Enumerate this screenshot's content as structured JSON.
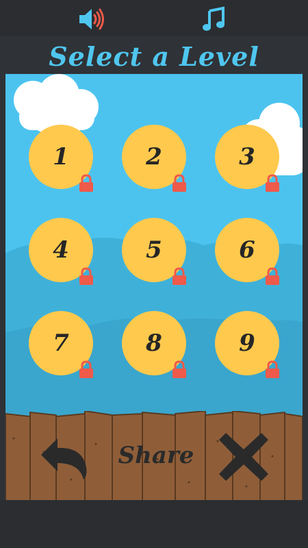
{
  "title": "Select a Level",
  "top_icons": {
    "sound": "speaker-icon",
    "music": "music-note-icon"
  },
  "levels": [
    {
      "number": "1",
      "locked": true
    },
    {
      "number": "2",
      "locked": true
    },
    {
      "number": "3",
      "locked": true
    },
    {
      "number": "4",
      "locked": true
    },
    {
      "number": "5",
      "locked": true
    },
    {
      "number": "6",
      "locked": true
    },
    {
      "number": "7",
      "locked": true
    },
    {
      "number": "8",
      "locked": true
    },
    {
      "number": "9",
      "locked": true
    }
  ],
  "controls": {
    "share_label": "Share",
    "back_icon": "back-arrow-icon",
    "close_icon": "close-x-icon"
  },
  "colors": {
    "sky": "#4cc3ef",
    "accent": "#4fc6ef",
    "coin": "#fec94d",
    "lock": "#ef5a4a",
    "wood": "#8a5a36",
    "bar": "#2b2d30"
  }
}
